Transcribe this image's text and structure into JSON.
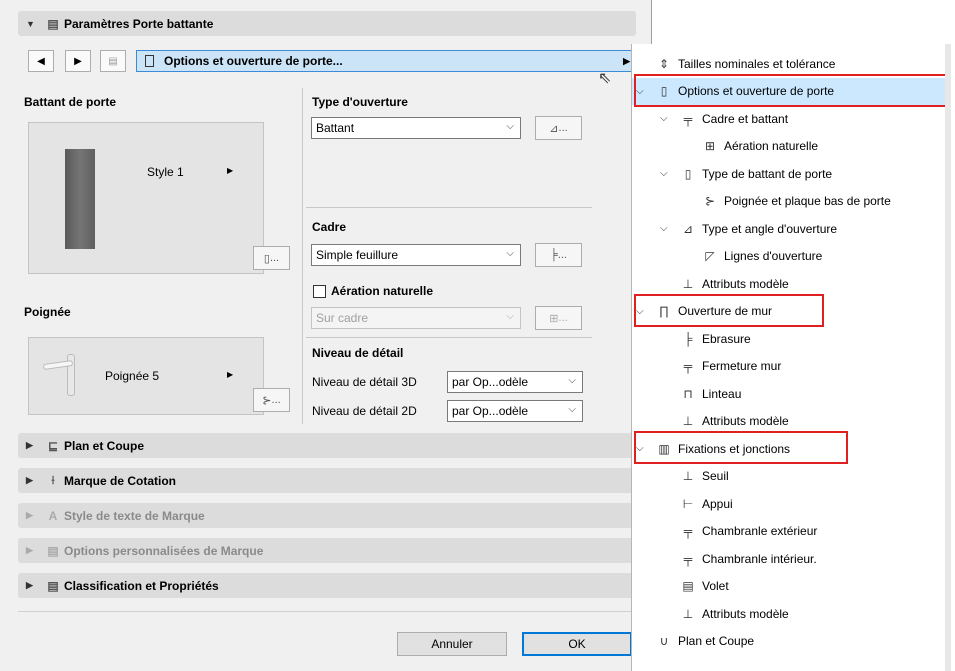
{
  "sections": {
    "door": {
      "label": "Paramètres Porte battante",
      "icon": "door-settings-icon"
    },
    "plan": {
      "label": "Plan et Coupe",
      "icon": "plan-section-icon"
    },
    "dimension": {
      "label": "Marque de Cotation",
      "icon": "dimension-marker-icon"
    },
    "text_style": {
      "label": "Style de texte de Marque",
      "icon": "text-style-icon"
    },
    "custom": {
      "label": "Options personnalisées de Marque",
      "icon": "custom-marker-icon"
    },
    "classification": {
      "label": "Classification et Propriétés",
      "icon": "classification-icon"
    }
  },
  "page_selector": {
    "current": "Options et ouverture de porte..."
  },
  "left": {
    "leaf_header": "Battant de porte",
    "leaf_style": "Style 1",
    "handle_header": "Poignée",
    "handle_style": "Poignée 5"
  },
  "right": {
    "opening_type_header": "Type d'ouverture",
    "opening_type_value": "Battant",
    "frame_header": "Cadre",
    "frame_value": "Simple feuillure",
    "ventilation_label": "Aération naturelle",
    "ventilation_value": "Sur cadre",
    "detail_header": "Niveau de détail",
    "detail_3d_label": "Niveau de détail 3D",
    "detail_3d_value": "par Op...odèle",
    "detail_2d_label": "Niveau de détail 2D",
    "detail_2d_value": "par Op...odèle"
  },
  "buttons": {
    "cancel": "Annuler",
    "ok": "OK",
    "ellipsis": "..."
  },
  "tree": [
    {
      "label": "Tailles nominales et tolérance",
      "icon": "nominal-size-icon"
    },
    {
      "label": "Options et ouverture de porte",
      "icon": "door-options-icon"
    },
    {
      "label": "Cadre et battant",
      "icon": "frame-leaf-icon"
    },
    {
      "label": "Aération naturelle",
      "icon": "ventilation-icon"
    },
    {
      "label": "Type de battant de porte",
      "icon": "leaf-type-icon"
    },
    {
      "label": "Poignée et plaque bas de porte",
      "icon": "handle-icon"
    },
    {
      "label": "Type et angle d'ouverture",
      "icon": "opening-angle-icon"
    },
    {
      "label": "Lignes d'ouverture",
      "icon": "opening-lines-icon"
    },
    {
      "label": "Attributs modèle",
      "icon": "model-attributes-icon"
    },
    {
      "label": "Ouverture de mur",
      "icon": "wall-opening-icon"
    },
    {
      "label": "Ebrasure",
      "icon": "reveal-icon"
    },
    {
      "label": "Fermeture mur",
      "icon": "wall-closure-icon"
    },
    {
      "label": "Linteau",
      "icon": "lintel-icon"
    },
    {
      "label": "Attributs modèle",
      "icon": "model-attributes-icon"
    },
    {
      "label": "Fixations et jonctions",
      "icon": "fixtures-icon"
    },
    {
      "label": "Seuil",
      "icon": "threshold-icon"
    },
    {
      "label": "Appui",
      "icon": "sill-icon"
    },
    {
      "label": "Chambranle extérieur",
      "icon": "exterior-casing-icon"
    },
    {
      "label": "Chambranle intérieur.",
      "icon": "interior-casing-icon"
    },
    {
      "label": "Volet",
      "icon": "shutter-icon"
    },
    {
      "label": "Attributs modèle",
      "icon": "model-attributes-icon"
    },
    {
      "label": "Plan et Coupe",
      "icon": "plan-section-icon"
    }
  ],
  "colors": {
    "selection": "#cce8ff",
    "highlight_box": "#e02020",
    "accent": "#3c8ad8"
  }
}
